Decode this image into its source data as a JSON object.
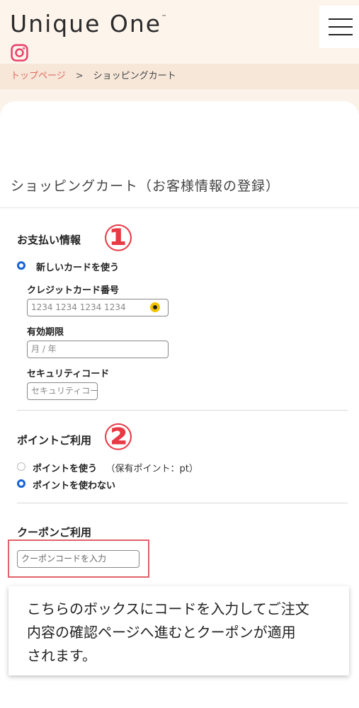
{
  "header": {
    "logo_text": "Unique One",
    "logo_tm": "™"
  },
  "icons": {
    "instagram": "instagram-icon",
    "menu": "hamburger-menu-icon"
  },
  "breadcrumb": {
    "home": "トップページ",
    "separator": ">",
    "current": "ショッピングカート"
  },
  "page": {
    "title": "ショッピングカート（お客様情報の登録）"
  },
  "payment": {
    "title": "お支払い情報",
    "new_card_label": "新しいカードを使う",
    "card_number_label": "クレジットカード番号",
    "card_number_placeholder": "1234 1234 1234 1234",
    "expiry_label": "有効期限",
    "expiry_placeholder": "月 / 年",
    "cvc_label": "セキュリティコード",
    "cvc_placeholder": "セキュリティコード"
  },
  "points": {
    "title": "ポイントご利用",
    "use_label": "ポイントを使う",
    "held_points": "（保有ポイント：pt）",
    "no_use_label": "ポイントを使わない"
  },
  "coupon": {
    "title": "クーポンご利用",
    "placeholder": "クーポンコードを入力"
  },
  "annotations": {
    "mark1": "①",
    "mark2": "②",
    "callout_line1": "こちらのボックスにコードを入力してご注文",
    "callout_line2": "内容の確認ページへ進むとクーポンが適用",
    "callout_line3": "されます。"
  },
  "colors": {
    "accent_red": "#e83a45",
    "breadcrumb_link": "#e06a5b",
    "radio_blue": "#1565d8",
    "header_bg": "#fdf4ec"
  }
}
